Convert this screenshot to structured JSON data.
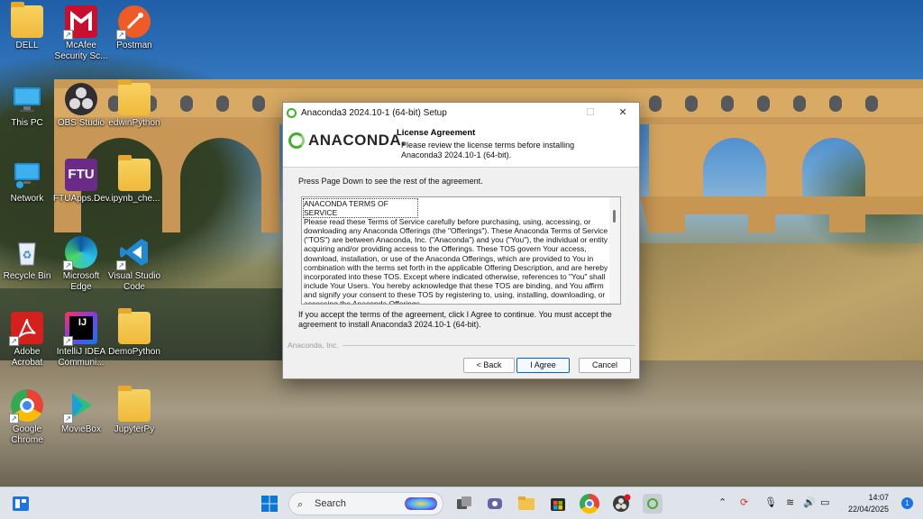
{
  "desktop": {
    "icons": [
      {
        "label": "DELL",
        "icon": "folder-icon"
      },
      {
        "label": "McAfee Security Sc...",
        "icon": "mcafee-icon"
      },
      {
        "label": "Postman",
        "icon": "postman-icon"
      },
      {
        "label": "This PC",
        "icon": "monitor-icon"
      },
      {
        "label": "OBS Studio",
        "icon": "obs-icon"
      },
      {
        "label": "edwinPython",
        "icon": "folder-icon"
      },
      {
        "label": "Network",
        "icon": "network-icon"
      },
      {
        "label": "FTUApps.Dev",
        "icon": "ftu-icon",
        "glyph_text": "FTU"
      },
      {
        "label": ".ipynb_che...",
        "icon": "folder-icon"
      },
      {
        "label": "Recycle Bin",
        "icon": "recycle-bin-icon"
      },
      {
        "label": "Microsoft Edge",
        "icon": "edge-icon"
      },
      {
        "label": "Visual Studio Code",
        "icon": "vscode-icon"
      },
      {
        "label": "Adobe Acrobat",
        "icon": "acrobat-icon"
      },
      {
        "label": "IntelliJ IDEA Communi...",
        "icon": "intellij-icon",
        "glyph_text": "IJ"
      },
      {
        "label": "DemoPython",
        "icon": "folder-icon"
      },
      {
        "label": "Google Chrome",
        "icon": "chrome-icon"
      },
      {
        "label": "MovieBox",
        "icon": "moviebox-icon"
      },
      {
        "label": "JupyterPy",
        "icon": "folder-icon"
      }
    ]
  },
  "dialog": {
    "title": "Anaconda3 2024.10-1 (64-bit) Setup",
    "logo_text": "ANACONDA.",
    "header_title": "License Agreement",
    "header_subtitle": "Please review the license terms before installing Anaconda3 2024.10-1 (64-bit).",
    "instruction": "Press Page Down to see the rest of the agreement.",
    "license_heading": "ANACONDA TERMS OF SERVICE",
    "license_body": "Please read these Terms of Service carefully before purchasing, using, accessing, or downloading any Anaconda Offerings (the \"Offerings\"). These Anaconda Terms of Service (\"TOS\") are between Anaconda, Inc. (\"Anaconda\") and you (\"You\"), the individual or entity acquiring and/or providing access to the Offerings. These TOS govern Your access, download, installation, or use of the Anaconda Offerings, which are provided to You in combination with the terms set forth in the applicable Offering Description, and are hereby incorporated into these TOS. Except where indicated otherwise, references to \"You\" shall include Your Users. You hereby acknowledge that these TOS are binding, and You affirm and signify your consent to these TOS by registering to, using, installing, downloading, or accessing the Anaconda Offerings",
    "accept_text": "If you accept the terms of the agreement, click I Agree to continue. You must accept the agreement to install Anaconda3 2024.10-1 (64-bit).",
    "brand_footer": "Anaconda, Inc.",
    "buttons": {
      "back": "< Back",
      "agree": "I Agree",
      "cancel": "Cancel"
    },
    "window_controls": {
      "minimize": "—",
      "maximize": "☐",
      "close": "✕"
    }
  },
  "taskbar": {
    "search_placeholder": "Search",
    "clock_time": "14:07",
    "clock_date": "22/04/2025",
    "notification_count": "1"
  },
  "colors": {
    "anaconda_green": "#43b02a",
    "accent_blue": "#0067c0",
    "taskbar_bg": "#dfe3ea"
  }
}
